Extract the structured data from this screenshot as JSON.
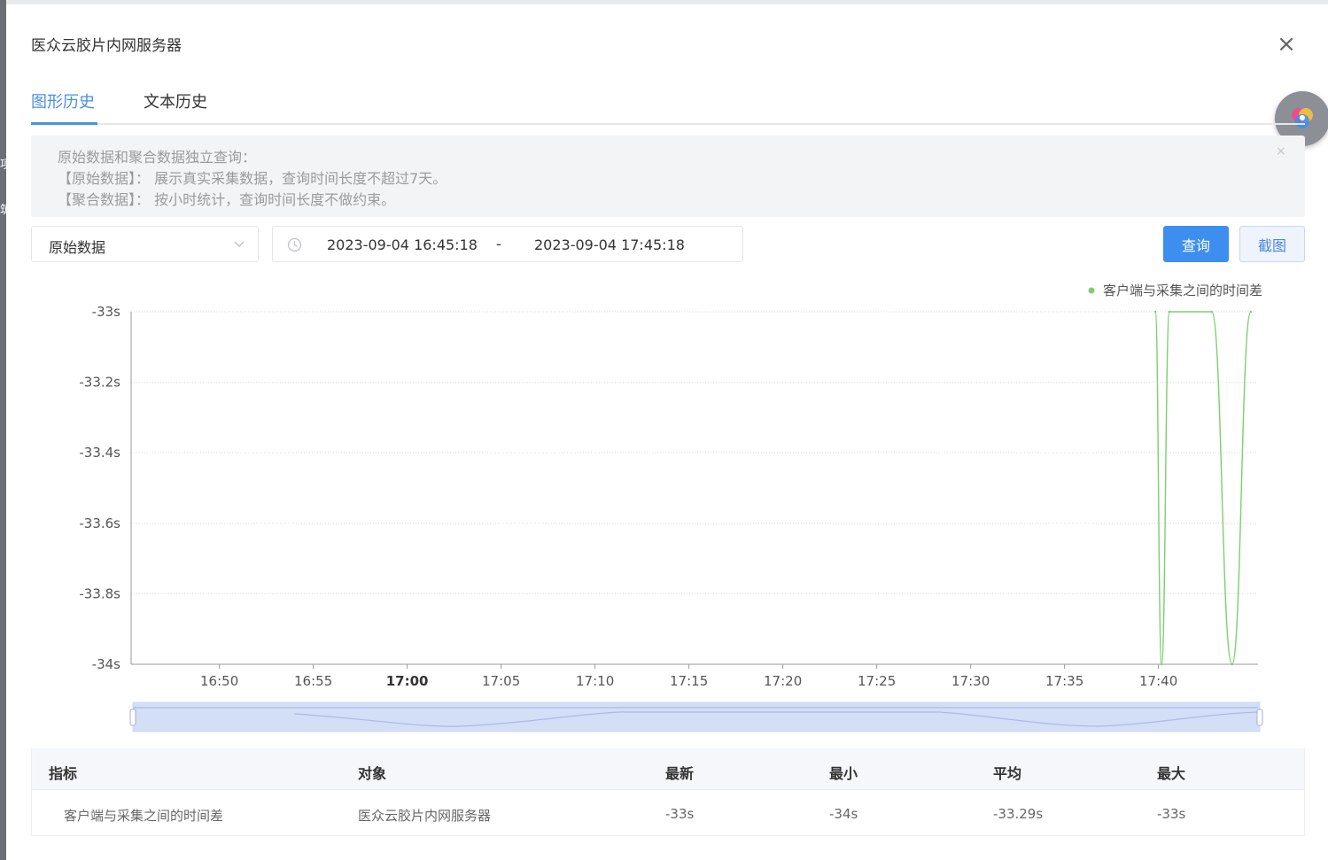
{
  "dialog": {
    "title": "医众云胶片内网服务器",
    "close_glyph": "×"
  },
  "tabs": [
    {
      "label": "图形历史",
      "active": true
    },
    {
      "label": "文本历史",
      "active": false
    }
  ],
  "notice": {
    "lines": [
      "原始数据和聚合数据独立查询：",
      "【原始数据】：  展示真实采集数据，查询时间长度不超过7天。",
      "【聚合数据】：  按小时统计，查询时间长度不做约束。"
    ],
    "close_glyph": "×"
  },
  "filters": {
    "data_type": "原始数据",
    "range_start": "2023-09-04 16:45:18",
    "range_separator": "-",
    "range_end": "2023-09-04 17:45:18"
  },
  "buttons": {
    "query": "查询",
    "screenshot": "截图"
  },
  "left_edge_glyphs": [
    "项",
    "筑"
  ],
  "colors": {
    "accent": "#3e8ef0",
    "series": "#7ccf6e"
  },
  "chart_data": {
    "type": "line",
    "title": "",
    "xlabel": "",
    "ylabel": "",
    "x_ticks": [
      "16:50",
      "16:55",
      "17:00",
      "17:05",
      "17:10",
      "17:15",
      "17:20",
      "17:25",
      "17:30",
      "17:35",
      "17:40"
    ],
    "x_ticks_bold": [
      "17:00"
    ],
    "y_ticks": [
      "-33s",
      "-33.2s",
      "-33.4s",
      "-33.6s",
      "-33.8s",
      "-34s"
    ],
    "ylim": [
      -34,
      -33
    ],
    "xlim": [
      "16:45:18",
      "17:45:18"
    ],
    "grid": true,
    "legend_position": "top-right",
    "series": [
      {
        "name": "客户端与采集之间的时间差",
        "color": "#7ccf6e",
        "points": [
          {
            "x": "17:39:50",
            "y": -33
          },
          {
            "x": "17:40:10",
            "y": -34
          },
          {
            "x": "17:40:35",
            "y": -33
          },
          {
            "x": "17:42:50",
            "y": -33
          },
          {
            "x": "17:43:55",
            "y": -34
          },
          {
            "x": "17:44:55",
            "y": -33
          }
        ]
      }
    ],
    "data_zoom": {
      "start_percent": 0,
      "end_percent": 100
    }
  },
  "table": {
    "headers": [
      "指标",
      "对象",
      "最新",
      "最小",
      "平均",
      "最大"
    ],
    "rows": [
      [
        "客户端与采集之间的时间差",
        "医众云胶片内网服务器",
        "-33s",
        "-34s",
        "-33.29s",
        "-33s"
      ]
    ]
  }
}
